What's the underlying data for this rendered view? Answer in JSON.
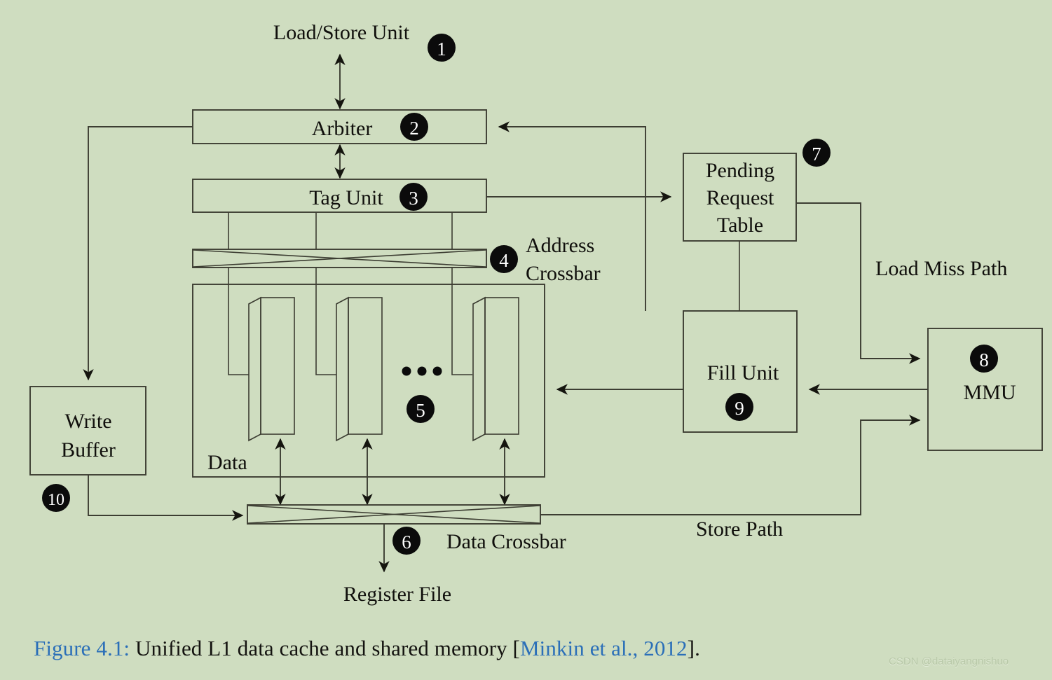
{
  "figure": {
    "background_color": "#cfddc0",
    "line_color": "#3c3d32",
    "badge_color": "#0b0b0b",
    "caption_link_color": "#2b6fb8",
    "caption_prefix": "Figure 4.1:",
    "caption_body": " Unified L1 data cache and shared memory [",
    "caption_citation": "Minkin et al., 2012",
    "caption_suffix": "].",
    "watermark": "CSDN @dataiyangnishuo"
  },
  "nodes": {
    "load_store_unit": {
      "label": "Load/Store Unit",
      "badge": "1"
    },
    "arbiter": {
      "label": "Arbiter",
      "badge": "2"
    },
    "tag_unit": {
      "label": "Tag Unit",
      "badge": "3"
    },
    "address_crossbar": {
      "label_line1": "Address",
      "label_line2": "Crossbar",
      "badge": "4"
    },
    "data": {
      "label": "Data",
      "badge": "5",
      "ellipsis": "• • •"
    },
    "data_crossbar": {
      "label": "Data Crossbar",
      "badge": "6"
    },
    "pending_request_table": {
      "label_line1": "Pending",
      "label_line2": "Request",
      "label_line3": "Table",
      "badge": "7"
    },
    "mmu": {
      "label": "MMU",
      "badge": "8"
    },
    "fill_unit": {
      "label": "Fill Unit",
      "badge": "9"
    },
    "write_buffer": {
      "label_line1": "Write",
      "label_line2": "Buffer",
      "badge": "10"
    },
    "register_file": {
      "label": "Register File"
    }
  },
  "path_labels": {
    "load_miss_path": "Load Miss Path",
    "store_path": "Store Path"
  }
}
